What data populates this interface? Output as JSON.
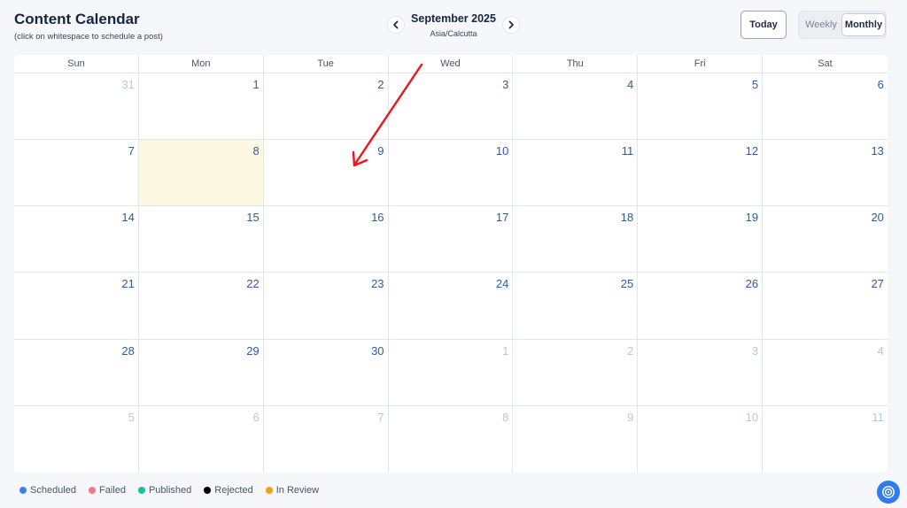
{
  "header": {
    "title": "Content Calendar",
    "subtitle": "(click on whitespace to schedule a post)",
    "month_label": "September 2025",
    "timezone": "Asia/Calcutta",
    "today_label": "Today",
    "weekly_label": "Weekly",
    "monthly_label": "Monthly",
    "active_view": "Monthly"
  },
  "weekdays": [
    "Sun",
    "Mon",
    "Tue",
    "Wed",
    "Thu",
    "Fri",
    "Sat"
  ],
  "weeks": [
    [
      {
        "d": "31",
        "out": true
      },
      {
        "d": "1"
      },
      {
        "d": "2"
      },
      {
        "d": "3"
      },
      {
        "d": "4"
      },
      {
        "d": "5"
      },
      {
        "d": "6"
      }
    ],
    [
      {
        "d": "7"
      },
      {
        "d": "8",
        "today": true
      },
      {
        "d": "9"
      },
      {
        "d": "10"
      },
      {
        "d": "11"
      },
      {
        "d": "12"
      },
      {
        "d": "13"
      }
    ],
    [
      {
        "d": "14"
      },
      {
        "d": "15"
      },
      {
        "d": "16"
      },
      {
        "d": "17"
      },
      {
        "d": "18"
      },
      {
        "d": "19"
      },
      {
        "d": "20"
      }
    ],
    [
      {
        "d": "21"
      },
      {
        "d": "22"
      },
      {
        "d": "23"
      },
      {
        "d": "24"
      },
      {
        "d": "25"
      },
      {
        "d": "26"
      },
      {
        "d": "27"
      }
    ],
    [
      {
        "d": "28"
      },
      {
        "d": "29"
      },
      {
        "d": "30"
      },
      {
        "d": "1",
        "out": true
      },
      {
        "d": "2",
        "out": true
      },
      {
        "d": "3",
        "out": true
      },
      {
        "d": "4",
        "out": true
      }
    ],
    [
      {
        "d": "5",
        "out": true
      },
      {
        "d": "6",
        "out": true
      },
      {
        "d": "7",
        "out": true
      },
      {
        "d": "8",
        "out": true
      },
      {
        "d": "9",
        "out": true
      },
      {
        "d": "10",
        "out": true
      },
      {
        "d": "11",
        "out": true
      }
    ]
  ],
  "legend": [
    {
      "label": "Scheduled",
      "color": "#3b82f6"
    },
    {
      "label": "Failed",
      "color": "#f07a8a"
    },
    {
      "label": "Published",
      "color": "#14c2a0"
    },
    {
      "label": "Rejected",
      "color": "#000000"
    },
    {
      "label": "In Review",
      "color": "#f59e0b"
    }
  ],
  "colors": {
    "today_highlight": "#fdf8e1",
    "annotation_arrow": "#e8151b",
    "accent": "#2f7bf0"
  },
  "icons": {
    "prev": "chevron-left-icon",
    "next": "chevron-right-icon",
    "help": "support-icon"
  }
}
